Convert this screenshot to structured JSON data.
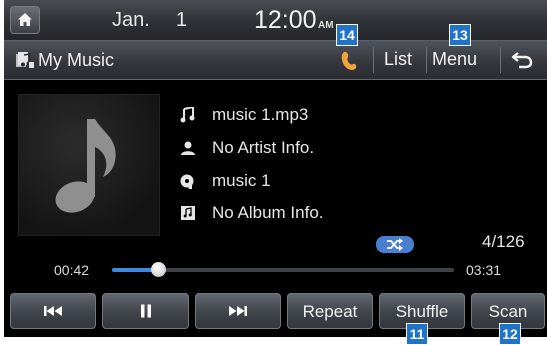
{
  "status": {
    "date_month": "Jan.",
    "date_day": "1",
    "time": "12:00",
    "ampm": "AM"
  },
  "header": {
    "title": "My Music",
    "list_label": "List",
    "menu_label": "Menu"
  },
  "track": {
    "file": "music 1.mp3",
    "artist": "No Artist Info.",
    "title": "music 1",
    "album": "No Album Info."
  },
  "playback": {
    "counter": "4/126",
    "elapsed": "00:42",
    "duration": "03:31",
    "progress": 0.135
  },
  "controls": {
    "repeat_label": "Repeat",
    "shuffle_label": "Shuffle",
    "scan_label": "Scan"
  },
  "callouts": {
    "c11": "11",
    "c12": "12",
    "c13": "13",
    "c14": "14"
  },
  "icons": [
    "home-icon",
    "music-folder-icon",
    "phone-icon",
    "back-icon",
    "note-icon",
    "artist-icon",
    "title-icon",
    "album-icon",
    "shuffle-icon",
    "previous-icon",
    "pause-icon",
    "next-icon"
  ],
  "colors": {
    "accent": "#3c8be0",
    "callout": "#1f73c9"
  }
}
